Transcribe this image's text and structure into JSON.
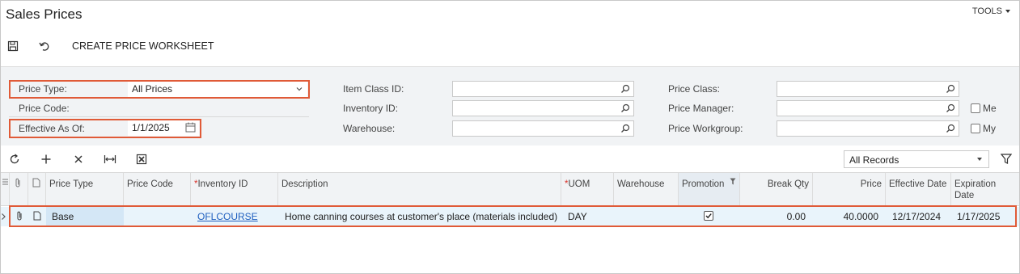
{
  "header": {
    "title": "Sales Prices",
    "tools_label": "TOOLS"
  },
  "toolbar": {
    "save_icon": "save-icon",
    "undo_icon": "undo-icon",
    "create_worksheet_label": "CREATE PRICE WORKSHEET"
  },
  "filters": {
    "price_type": {
      "label": "Price Type:",
      "value": "All Prices"
    },
    "price_code": {
      "label": "Price Code:"
    },
    "effective_as_of": {
      "label": "Effective As Of:",
      "value": "1/1/2025"
    },
    "item_class_id": {
      "label": "Item Class ID:",
      "value": ""
    },
    "inventory_id": {
      "label": "Inventory ID:",
      "value": ""
    },
    "warehouse": {
      "label": "Warehouse:",
      "value": ""
    },
    "price_class": {
      "label": "Price Class:",
      "value": ""
    },
    "price_manager": {
      "label": "Price Manager:",
      "value": ""
    },
    "price_workgroup": {
      "label": "Price Workgroup:",
      "value": ""
    },
    "me_label": "Me",
    "my_label": "My"
  },
  "grid_toolbar": {
    "records_filter": "All Records",
    "icons": [
      "refresh-icon",
      "add-icon",
      "delete-icon",
      "fit-columns-icon",
      "excel-export-icon",
      "filter-icon"
    ]
  },
  "grid": {
    "columns": {
      "price_type": "Price Type",
      "price_code": "Price Code",
      "inventory_id": "Inventory ID",
      "description": "Description",
      "uom": "UOM",
      "warehouse": "Warehouse",
      "promotion": "Promotion",
      "break_qty": "Break Qty",
      "price": "Price",
      "effective_date": "Effective Date",
      "expiration_date": "Expiration Date"
    },
    "rows": [
      {
        "price_type": "Base",
        "price_code": "",
        "inventory_id": "OFLCOURSE",
        "description": "Home canning courses at customer's place (materials included)",
        "uom": "DAY",
        "warehouse": "",
        "promotion": true,
        "break_qty": "0.00",
        "price": "40.0000",
        "effective_date": "12/17/2024",
        "expiration_date": "1/17/2025"
      }
    ]
  },
  "colors": {
    "accent_outline": "#e05a37",
    "link": "#1f5fbf",
    "required_marker": "#d9342b",
    "panel_bg": "#f1f3f5",
    "row_selected_bg": "#e9f4fb"
  }
}
